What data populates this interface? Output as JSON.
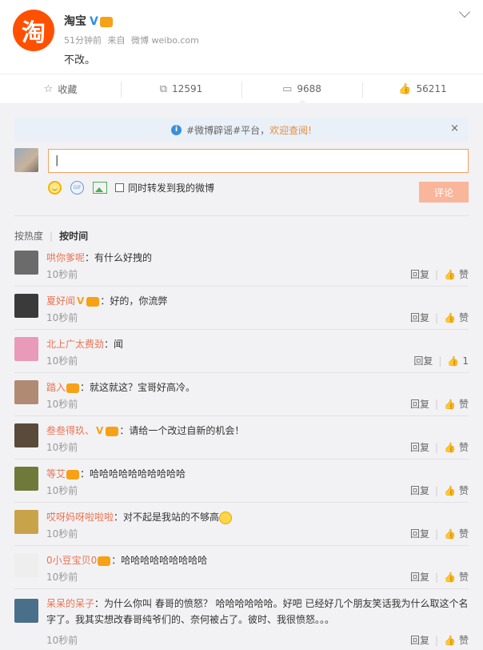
{
  "post": {
    "poster": "淘宝",
    "avatar_char": "淘",
    "time": "51分钟前",
    "source_prefix": "来自",
    "source": "微博 weibo.com",
    "text": "不改。"
  },
  "actions": {
    "favorite": "收藏",
    "repost": "12591",
    "comment": "9688",
    "like": "56211"
  },
  "notice": {
    "text": "#微博辟谣#平台，",
    "link": "欢迎查阅!",
    "close": "×"
  },
  "composer": {
    "value": "|",
    "repost_label": "同时转发到我的微博",
    "submit": "评论"
  },
  "sort": {
    "hot": "按热度",
    "time": "按时间"
  },
  "comments": [
    {
      "user": "哄你爹呢",
      "text": "：有什么好拽的",
      "time": "10秒前",
      "reply": "回复",
      "like": "赞",
      "avatar_color": "#6b6b6b"
    },
    {
      "user": "夏好闻",
      "text": "：好的，你流弊",
      "time": "10秒前",
      "reply": "回复",
      "like": "赞",
      "avatar_color": "#3a3a3a"
    },
    {
      "user": "北上广太费劲",
      "text": "：闻",
      "time": "10秒前",
      "reply": "回复",
      "like": "1",
      "avatar_color": "#e89ab8"
    },
    {
      "user": "踏入",
      "text": "：就这就这？宝哥好高冷。",
      "time": "10秒前",
      "reply": "回复",
      "like": "赞",
      "avatar_color": "#b08a72"
    },
    {
      "user": "叁叁得玖、",
      "text": "：请给一个改过自新的机会！",
      "time": "10秒前",
      "reply": "回复",
      "like": "赞",
      "avatar_color": "#5a4a3a"
    },
    {
      "user": "等艾",
      "text": "：哈哈哈哈哈哈哈哈哈哈",
      "time": "10秒前",
      "reply": "回复",
      "like": "赞",
      "avatar_color": "#6f7a3a"
    },
    {
      "user": "哎呀妈呀啦啦啦",
      "text": "：对不起是我站的不够高",
      "time": "10秒前",
      "reply": "回复",
      "like": "赞",
      "avatar_color": "#c9a34a"
    },
    {
      "user": "0小豆宝贝0",
      "text": "：哈哈哈哈哈哈哈哈哈",
      "time": "10秒前",
      "reply": "回复",
      "like": "赞",
      "avatar_color": "#eeeeee"
    },
    {
      "user": "呆呆的呆子",
      "text": "：为什么你叫 春哥的愤怒？ 哈哈哈哈哈哈。好吧 已经好几个朋友笑话我为什么取这个名字了。我其实想改春哥纯爷们的、奈何被占了。彼时、我很愤怒。。。",
      "time": "10秒前",
      "reply": "回复",
      "like": "赞",
      "avatar_color": "#4a6f8a"
    }
  ]
}
